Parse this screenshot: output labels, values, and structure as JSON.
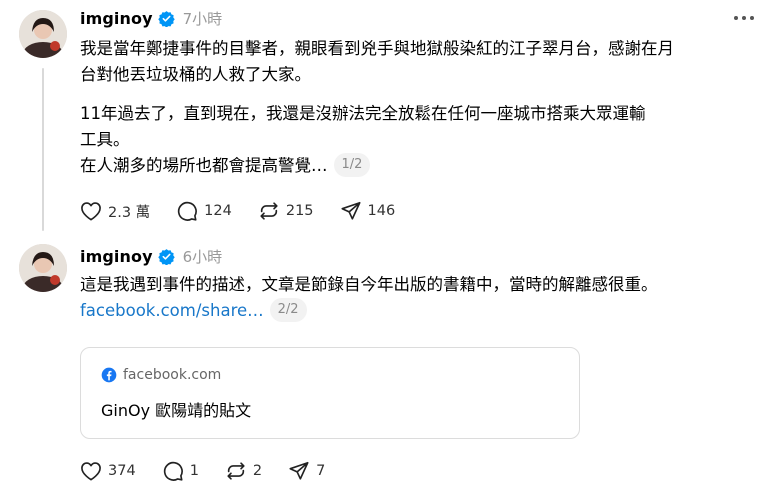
{
  "colors": {
    "link": "#1877c9",
    "verified": "#0095f6",
    "muted": "#999999",
    "facebook": "#1877f2"
  },
  "posts": [
    {
      "username": "imginoy",
      "time": "7小時",
      "paragraphs": [
        [
          "我是當年鄭捷事件的目擊者，親眼看到兇手與地獄般染紅的江子翠月台，感謝在月",
          "台對他丟垃圾桶的人救了大家。"
        ],
        [
          "11年過去了，直到現在，我還是沒辦法完全放鬆在任何一座城市搭乘大眾運輸",
          "工具。",
          "在人潮多的場所也都會提高警覺…"
        ]
      ],
      "pager": "1/2",
      "stats": {
        "likes": "2.3 萬",
        "comments": "124",
        "reposts": "215",
        "shares": "146"
      }
    },
    {
      "username": "imginoy",
      "time": "6小時",
      "text": "這是我遇到事件的描述，文章是節錄自今年出版的書籍中，當時的解離感很重。",
      "link": "facebook.com/share…",
      "pager": "2/2",
      "card": {
        "source": "facebook.com",
        "title": "GinOy 歐陽靖的貼文"
      },
      "stats": {
        "likes": "374",
        "comments": "1",
        "reposts": "2",
        "shares": "7"
      }
    }
  ]
}
